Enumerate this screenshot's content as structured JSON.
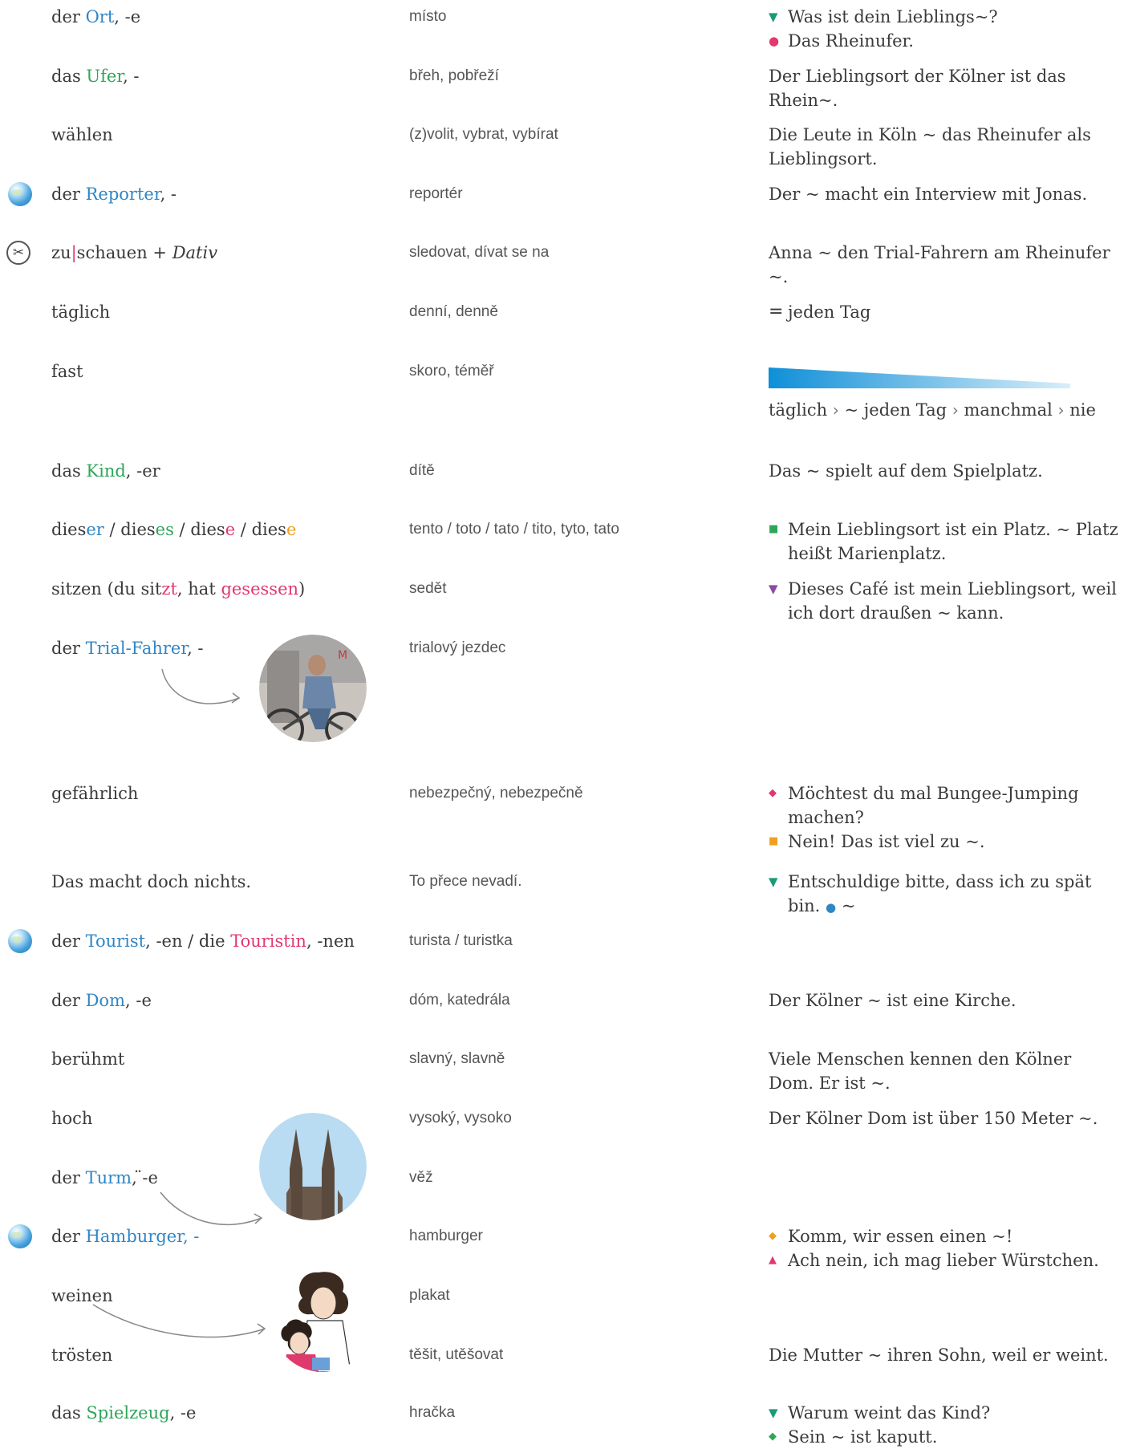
{
  "colors": {
    "blue": "#2f86c5",
    "green": "#2fa55a",
    "pink": "#e0396e",
    "orange": "#f0a020",
    "teal": "#1a9a7a",
    "purple": "#8a4aa8",
    "gradient_start": "#0f8fd8",
    "gradient_end": "#d9eef9"
  },
  "rows": {
    "ort": {
      "de": {
        "a": "der ",
        "b": "Ort",
        "c": ", -e"
      },
      "cz": "místo",
      "ex1": "Was ist dein Lieblings~?",
      "ex2": "Das Rheinufer."
    },
    "ufer": {
      "de": {
        "a": "das ",
        "b": "Ufer",
        "c": ", -"
      },
      "cz": "břeh, pobřeží",
      "ex": "Der Lieblingsort der Kölner ist das Rhein~."
    },
    "waehlen": {
      "de": "wählen",
      "cz": "(z)volit, vybrat, vybírat",
      "ex": "Die Leute in Köln ~ das Rheinufer als Lieblingsort."
    },
    "reporter": {
      "de": {
        "a": "der ",
        "b": "Reporter",
        "c": ", -"
      },
      "cz": "reportér",
      "ex": "Der ~ macht ein Interview mit Jonas.",
      "icon": "globe-icon"
    },
    "zuschauen": {
      "de": {
        "a": "zu",
        "sep": "|",
        "b": "schauen + ",
        "c": "Dativ"
      },
      "cz": "sledovat, dívat se na",
      "ex": "Anna ~ den Trial-Fahrern am Rheinufer ~.",
      "icon": "scissors-icon"
    },
    "taeglich": {
      "de": "täglich",
      "cz": "denní, denně",
      "eq": "=",
      "ex": "jeden Tag"
    },
    "fast": {
      "de": "fast",
      "cz": "skoro, téměř",
      "scale": [
        "täglich",
        "~ jeden Tag",
        "manchmal",
        "nie"
      ],
      "scale_sep": "›"
    },
    "kind": {
      "de": {
        "a": "das ",
        "b": "Kind",
        "c": ", -er"
      },
      "cz": "dítě",
      "ex": "Das ~ spielt auf dem Spielplatz."
    },
    "dieser": {
      "de": {
        "d1": "dies",
        "e1": "er",
        "s1": " / ",
        "d2": "dies",
        "e2": "es",
        "s2": " / ",
        "d3": "dies",
        "e3": "e",
        "s3": " / ",
        "d4": "dies",
        "e4": "e"
      },
      "cz": "tento / toto / tato / tito, tyto, tato",
      "ex": "Mein Lieblingsort ist ein Platz. ~ Platz heißt Marienplatz."
    },
    "sitzen": {
      "de": {
        "a": "sitzen (du sit",
        "b": "zt",
        "c": ", hat ",
        "d": "gesessen",
        "e": ")"
      },
      "cz": "sedět",
      "ex": "Dieses Café ist mein Lieblingsort, weil ich dort draußen ~ kann."
    },
    "trial": {
      "de": {
        "a": "der ",
        "b": "Trial-Fahrer",
        "c": ", -"
      },
      "cz": "trialový jezdec"
    },
    "gefaehrlich": {
      "de": "gefährlich",
      "cz": "nebezpečný, nebezpečně",
      "ex1": "Möchtest du mal Bungee-Jumping machen?",
      "ex2": "Nein! Das ist viel zu ~."
    },
    "nichts": {
      "de": "Das macht doch nichts.",
      "cz": "To přece nevadí.",
      "ex1": "Entschuldige bitte, dass ich zu spät bin.",
      "ex2": "~"
    },
    "tourist": {
      "de": {
        "a": "der ",
        "b": "Tourist",
        "c": ", -en / die ",
        "d": "Touristin",
        "e": ", -nen"
      },
      "cz": "turista / turistka"
    },
    "dom": {
      "de": {
        "a": "der ",
        "b": "Dom",
        "c": ", -e"
      },
      "cz": "dóm, katedrála",
      "ex": "Der Kölner ~ ist eine Kirche."
    },
    "beruehmt": {
      "de": "berühmt",
      "cz": "slavný, slavně",
      "ex": "Viele Menschen kennen den Kölner Dom. Er ist ~."
    },
    "hoch": {
      "de": "hoch",
      "cz": "vysoký, vysoko",
      "ex": "Der Kölner Dom ist über 150 Meter ~."
    },
    "turm": {
      "de": {
        "a": "der ",
        "b": "Turm",
        "c": ", ̈-e"
      },
      "cz": "věž"
    },
    "hamburger": {
      "de": {
        "a": "der ",
        "b": "Hamburger, -"
      },
      "cz": "hamburger",
      "ex1": "Komm, wir essen einen ~!",
      "ex2": "Ach nein, ich mag lieber Würstchen."
    },
    "weinen": {
      "de": "weinen",
      "cz": "plakat"
    },
    "troesten": {
      "de": "trösten",
      "cz": "těšit, utěšovat",
      "ex": "Die Mutter ~ ihren Sohn, weil er weint."
    },
    "spielzeug": {
      "de": {
        "a": "das ",
        "b": "Spielzeug",
        "c": ", -e"
      },
      "cz": "hračka",
      "ex1": "Warum weint das Kind?",
      "ex2": "Sein ~ ist kaputt."
    }
  },
  "markers": {
    "tri_down": "▼",
    "dot": "●",
    "square": "■",
    "diamond": "◆",
    "tri_up": "▲"
  }
}
